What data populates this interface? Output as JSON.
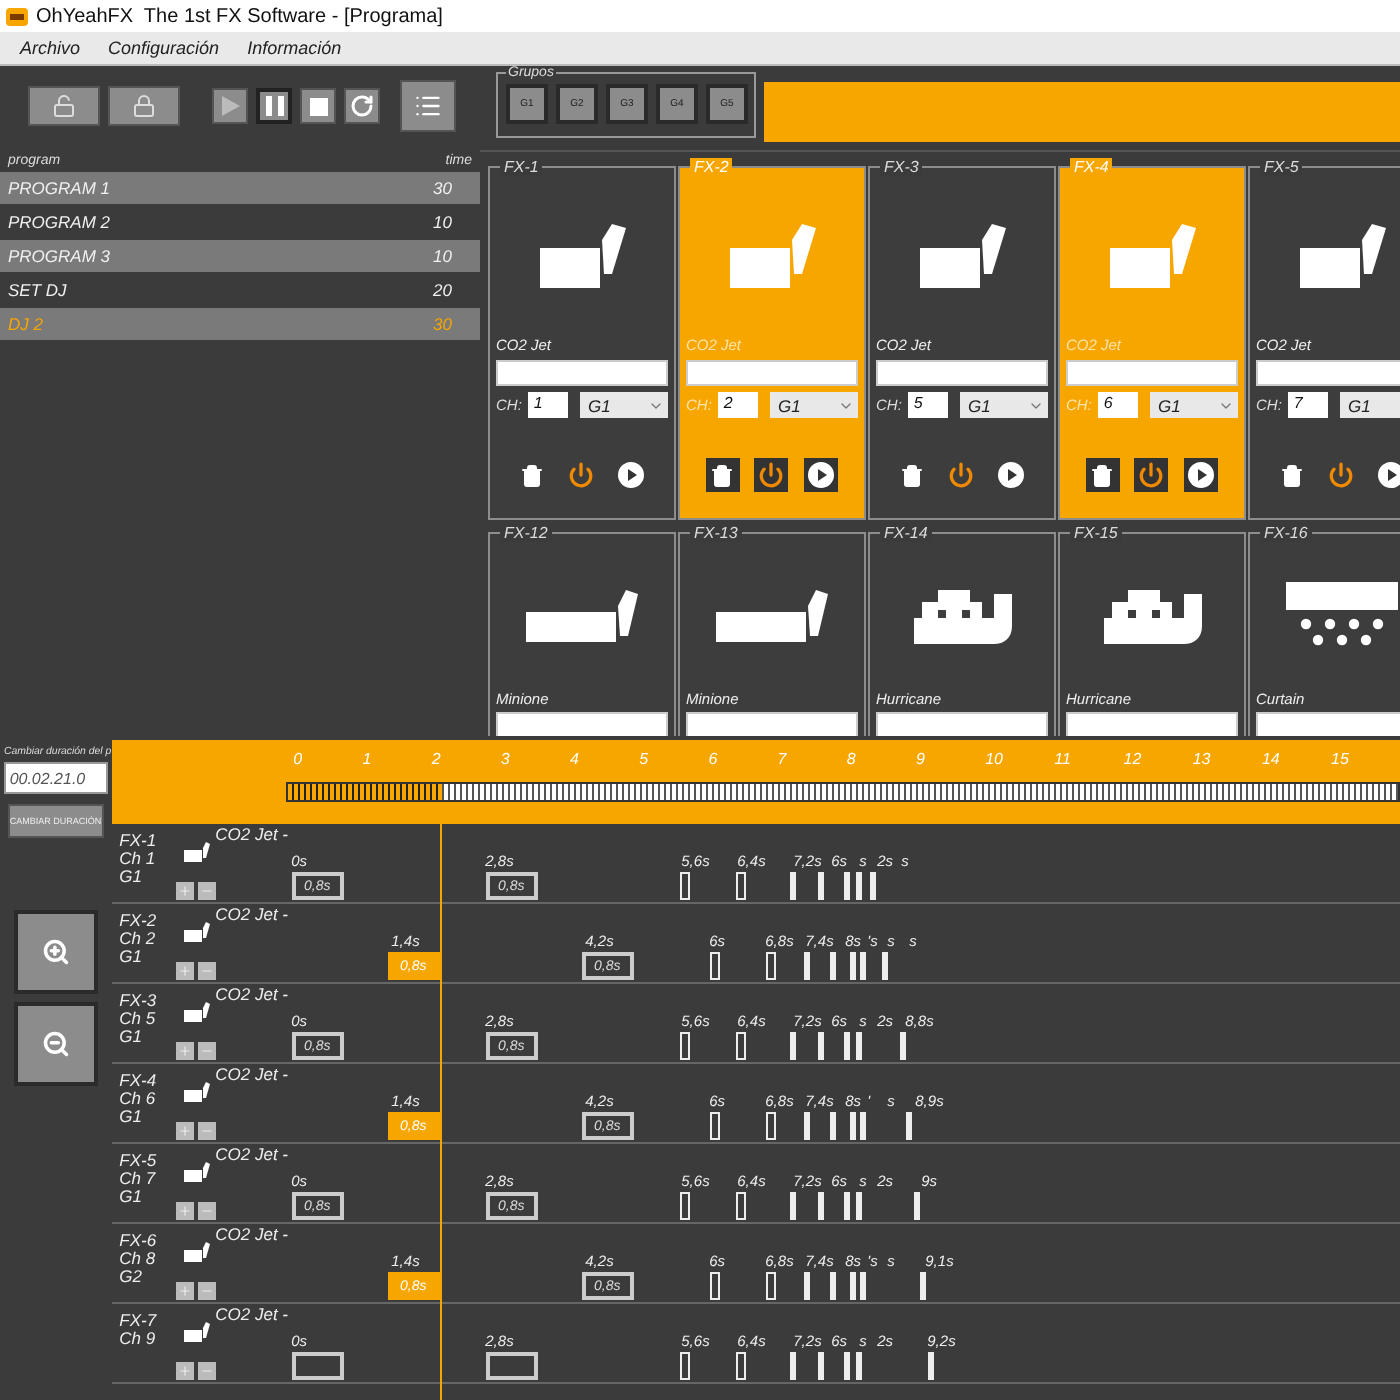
{
  "window": {
    "title": "OhYeahFX  The 1st FX Software - [Programa]"
  },
  "menu": [
    "Archivo",
    "Configuración",
    "Información"
  ],
  "groups": {
    "legend": "Grupos",
    "buttons": [
      "G1",
      "G2",
      "G3",
      "G4",
      "G5"
    ]
  },
  "programs": {
    "columns": [
      "program",
      "time"
    ],
    "rows": [
      {
        "name": "PROGRAM 1",
        "time": "30",
        "selected": false
      },
      {
        "name": "PROGRAM 2",
        "time": "10",
        "selected": false
      },
      {
        "name": "PROGRAM 3",
        "time": "10",
        "selected": false
      },
      {
        "name": "SET DJ",
        "time": "20",
        "selected": false
      },
      {
        "name": "DJ 2",
        "time": "30",
        "selected": true
      }
    ]
  },
  "fixture_rows": [
    [
      {
        "title": "FX-1",
        "name": "CO2 Jet",
        "kind": "jet",
        "selected": false,
        "channel_label": "CH:",
        "channel": "1",
        "group": "G1"
      },
      {
        "title": "FX-2",
        "name": "CO2 Jet",
        "kind": "jet",
        "selected": true,
        "channel_label": "CH:",
        "channel": "2",
        "group": "G1"
      },
      {
        "title": "FX-3",
        "name": "CO2 Jet",
        "kind": "jet",
        "selected": false,
        "channel_label": "CH:",
        "channel": "5",
        "group": "G1"
      },
      {
        "title": "FX-4",
        "name": "CO2 Jet",
        "kind": "jet",
        "selected": true,
        "channel_label": "CH:",
        "channel": "6",
        "group": "G1"
      },
      {
        "title": "FX-5",
        "name": "CO2 Jet",
        "kind": "jet",
        "selected": false,
        "channel_label": "CH:",
        "channel": "7",
        "group": "G1"
      }
    ],
    [
      {
        "title": "FX-12",
        "name": "Minione",
        "kind": "minione",
        "selected": false
      },
      {
        "title": "FX-13",
        "name": "Minione",
        "kind": "minione",
        "selected": false
      },
      {
        "title": "FX-14",
        "name": "Hurricane",
        "kind": "hurricane",
        "selected": false
      },
      {
        "title": "FX-15",
        "name": "Hurricane",
        "kind": "hurricane",
        "selected": false
      },
      {
        "title": "FX-16",
        "name": "Curtain",
        "kind": "curtain",
        "selected": false
      }
    ]
  ],
  "timeline": {
    "duration_label": "Cambiar duración del p",
    "duration_value": "00.02.21.0",
    "change_button": "CAMBIAR DURACIÓN",
    "ticks": [
      "0",
      "1",
      "2",
      "3",
      "4",
      "5",
      "6",
      "7",
      "8",
      "9",
      "10",
      "11",
      "12",
      "13",
      "14",
      "15"
    ],
    "progress": {
      "level": 0.14
    }
  },
  "tracks": [
    {
      "fx": "FX-1",
      "channel": "Ch 1",
      "group": "G1",
      "name": "CO2 Jet -",
      "labels": [
        "0s",
        "2,8s",
        "5,6s",
        "6,4s",
        "7,2s",
        "6s",
        "s",
        "2s",
        "s"
      ],
      "marks": [
        {
          "kind": "box",
          "value": "0,8s",
          "selected": false
        },
        {
          "kind": "box",
          "value": "0,8s",
          "selected": false
        },
        {
          "kind": "hollow"
        },
        {
          "kind": "hollow"
        },
        {
          "kind": "bar"
        },
        {
          "kind": "bar"
        },
        {
          "kind": "bar"
        },
        {
          "kind": "bar"
        },
        {
          "kind": "bar"
        }
      ]
    },
    {
      "fx": "FX-2",
      "channel": "Ch 2",
      "group": "G1",
      "name": "CO2 Jet -",
      "labels": [
        "1,4s",
        "4,2s",
        "6s",
        "6,8s",
        "7,4s",
        "8s",
        "'s",
        "s",
        "s"
      ],
      "marks": [
        {
          "kind": "box",
          "value": "0,8s",
          "selected": true
        },
        {
          "kind": "box",
          "value": "0,8s",
          "selected": false
        },
        {
          "kind": "hollow"
        },
        {
          "kind": "hollow"
        },
        {
          "kind": "bar"
        },
        {
          "kind": "bar"
        },
        {
          "kind": "bar"
        },
        {
          "kind": "bar"
        },
        {
          "kind": "bar"
        }
      ]
    },
    {
      "fx": "FX-3",
      "channel": "Ch 5",
      "group": "G1",
      "name": "CO2 Jet -",
      "labels": [
        "0s",
        "2,8s",
        "5,6s",
        "6,4s",
        "7,2s",
        "6s",
        "s",
        "2s",
        "8,8s"
      ],
      "marks": [
        {
          "kind": "box",
          "value": "0,8s",
          "selected": false
        },
        {
          "kind": "box",
          "value": "0,8s",
          "selected": false
        },
        {
          "kind": "hollow"
        },
        {
          "kind": "hollow"
        },
        {
          "kind": "bar"
        },
        {
          "kind": "bar"
        },
        {
          "kind": "bar"
        },
        {
          "kind": "bar"
        },
        {
          "kind": "bar"
        }
      ]
    },
    {
      "fx": "FX-4",
      "channel": "Ch 6",
      "group": "G1",
      "name": "CO2 Jet -",
      "labels": [
        "1,4s",
        "4,2s",
        "6s",
        "6,8s",
        "7,4s",
        "8s",
        "'",
        "s",
        "8,9s"
      ],
      "marks": [
        {
          "kind": "box",
          "value": "0,8s",
          "selected": true
        },
        {
          "kind": "box",
          "value": "0,8s",
          "selected": false
        },
        {
          "kind": "hollow"
        },
        {
          "kind": "hollow"
        },
        {
          "kind": "bar"
        },
        {
          "kind": "bar"
        },
        {
          "kind": "bar"
        },
        {
          "kind": "bar"
        },
        {
          "kind": "bar"
        }
      ]
    },
    {
      "fx": "FX-5",
      "channel": "Ch 7",
      "group": "G1",
      "name": "CO2 Jet -",
      "labels": [
        "0s",
        "2,8s",
        "5,6s",
        "6,4s",
        "7,2s",
        "6s",
        "s",
        "2s",
        "9s"
      ],
      "marks": [
        {
          "kind": "box",
          "value": "0,8s",
          "selected": false
        },
        {
          "kind": "box",
          "value": "0,8s",
          "selected": false
        },
        {
          "kind": "hollow"
        },
        {
          "kind": "hollow"
        },
        {
          "kind": "bar"
        },
        {
          "kind": "bar"
        },
        {
          "kind": "bar"
        },
        {
          "kind": "bar"
        },
        {
          "kind": "bar"
        }
      ]
    },
    {
      "fx": "FX-6",
      "channel": "Ch 8",
      "group": "G2",
      "name": "CO2 Jet -",
      "labels": [
        "1,4s",
        "4,2s",
        "6s",
        "6,8s",
        "7,4s",
        "8s",
        "'s",
        "s",
        "9,1s"
      ],
      "marks": [
        {
          "kind": "box",
          "value": "0,8s",
          "selected": true
        },
        {
          "kind": "box",
          "value": "0,8s",
          "selected": false
        },
        {
          "kind": "hollow"
        },
        {
          "kind": "hollow"
        },
        {
          "kind": "bar"
        },
        {
          "kind": "bar"
        },
        {
          "kind": "bar"
        },
        {
          "kind": "bar"
        },
        {
          "kind": "bar"
        }
      ]
    },
    {
      "fx": "FX-7",
      "channel": "Ch 9",
      "name": "CO2 Jet -",
      "labels": [
        "0s",
        "2,8s",
        "5,6s",
        "6,4s",
        "7,2s",
        "6s",
        "s",
        "2s",
        "9,2s"
      ],
      "marks": [
        {
          "kind": "box",
          "selected": false
        },
        {
          "kind": "box",
          "selected": false
        },
        {
          "kind": "hollow"
        },
        {
          "kind": "hollow"
        },
        {
          "kind": "bar"
        },
        {
          "kind": "bar"
        },
        {
          "kind": "bar"
        },
        {
          "kind": "bar"
        },
        {
          "kind": "bar"
        }
      ]
    }
  ]
}
